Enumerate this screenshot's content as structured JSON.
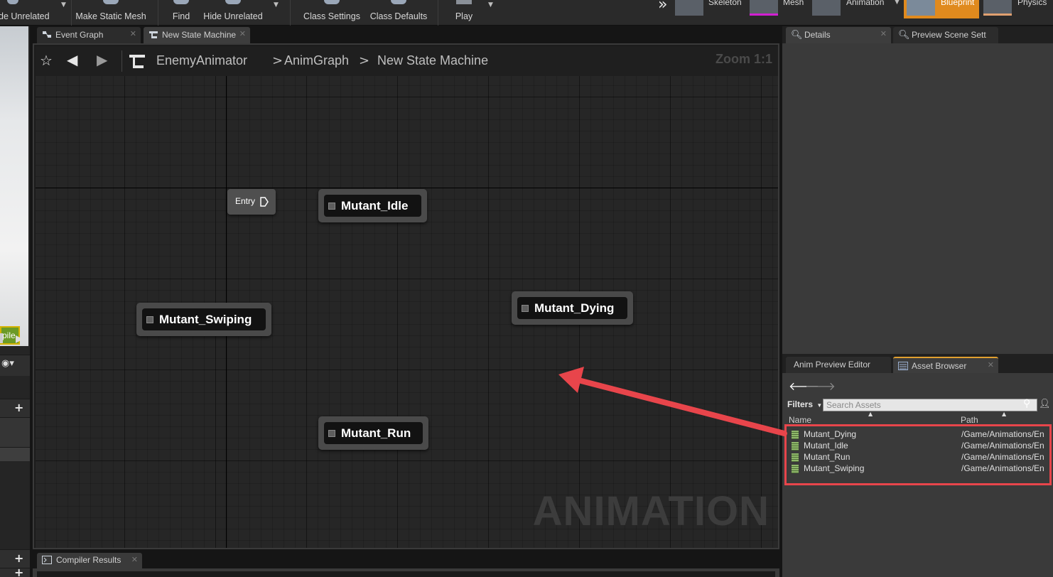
{
  "toolbar": {
    "buttons": [
      {
        "label": "de Unrelated"
      },
      {
        "label": "Make Static Mesh"
      },
      {
        "label": "Find"
      },
      {
        "label": "Hide Unrelated"
      },
      {
        "label": "Class Settings"
      },
      {
        "label": "Class Defaults"
      },
      {
        "label": "Play"
      }
    ],
    "modes": [
      {
        "label": "Skeleton"
      },
      {
        "label": "Mesh"
      },
      {
        "label": "Animation"
      },
      {
        "label": "Blueprint"
      },
      {
        "label": "Physics"
      }
    ],
    "overflow_glyph": "»"
  },
  "left_strip": {
    "compile_label": "pile"
  },
  "tabs": {
    "event_graph": "Event Graph",
    "state_machine": "New State Machine"
  },
  "graph": {
    "breadcrumb": {
      "asset": "EnemyAnimator",
      "sep1": ">",
      "graph": "AnimGraph",
      "sep2": ">",
      "current": "New State Machine"
    },
    "zoom": "Zoom 1:1",
    "watermark": "ANIMATION",
    "entry_label": "Entry",
    "states": {
      "idle": "Mutant_Idle",
      "swiping": "Mutant_Swiping",
      "dying": "Mutant_Dying",
      "run": "Mutant_Run"
    }
  },
  "bottom": {
    "compiler_results": "Compiler Results"
  },
  "right": {
    "tabs": {
      "details": "Details",
      "preview_scene": "Preview Scene Sett",
      "anim_preview": "Anim Preview Editor",
      "asset_browser": "Asset Browser"
    },
    "filters_label": "Filters",
    "search_placeholder": "Search Assets",
    "columns": {
      "name": "Name",
      "path": "Path"
    },
    "assets": [
      {
        "name": "Mutant_Dying",
        "path": "/Game/Animations/En"
      },
      {
        "name": "Mutant_Idle",
        "path": "/Game/Animations/En"
      },
      {
        "name": "Mutant_Run",
        "path": "/Game/Animations/En"
      },
      {
        "name": "Mutant_Swiping",
        "path": "/Game/Animations/En"
      }
    ]
  },
  "colors": {
    "accent_orange": "#e08a1e",
    "annotation_red": "#e8454b",
    "compile_green": "#6b9a26"
  }
}
